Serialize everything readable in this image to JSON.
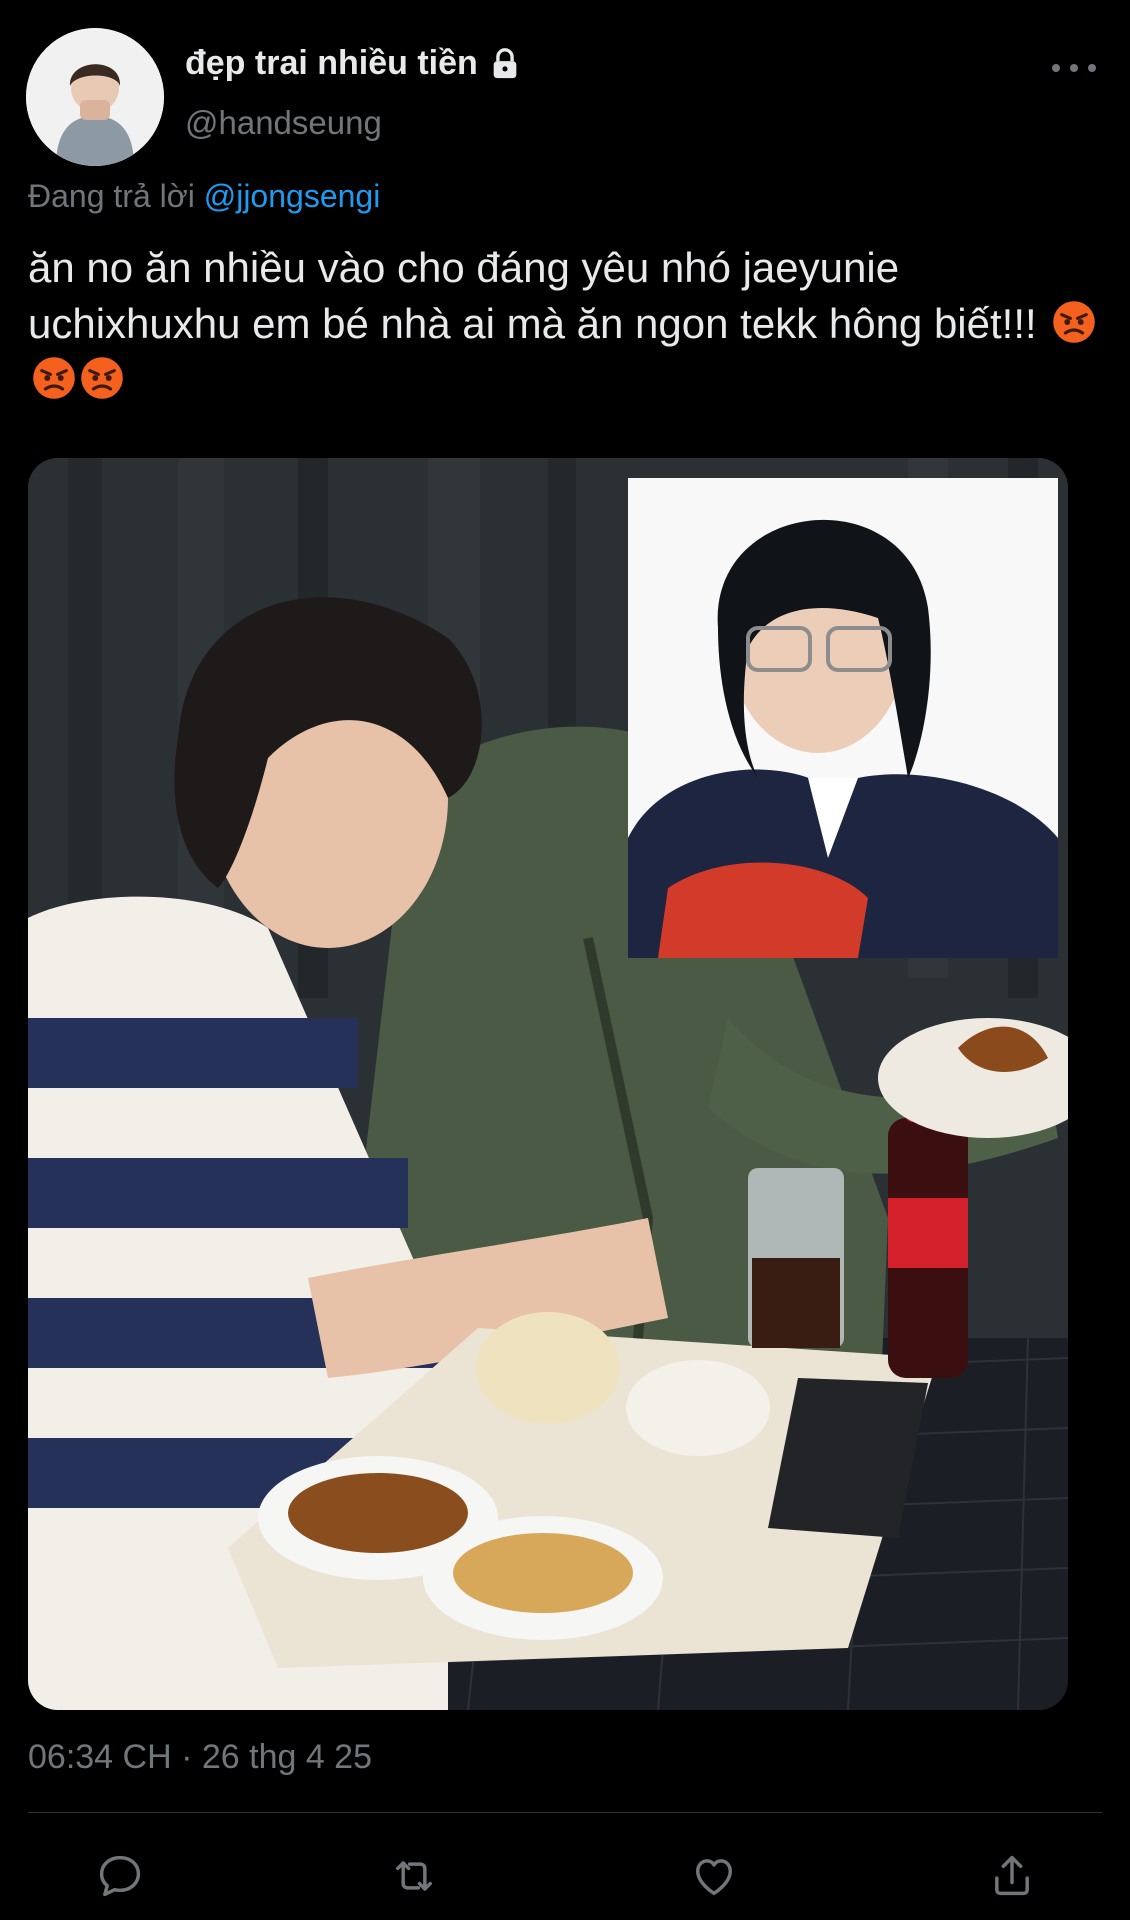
{
  "user": {
    "display_name": "đẹp trai nhiều tiền",
    "handle": "@handseung",
    "avatar_icon": "avatar",
    "protected_icon": "lock-icon"
  },
  "reply": {
    "prefix": "Đang trả lời ",
    "mention": "@jjongsengi"
  },
  "tweet": {
    "text": "ăn no ăn nhiều vào cho đáng yêu nhó jaeyunie uchixhuxhu em bé nhà ai mà ăn ngon tekk hông biết!!!",
    "emojis": [
      "angry-face-emoji",
      "angry-face-emoji",
      "angry-face-emoji"
    ]
  },
  "media": {
    "type": "photo",
    "icon": "photo"
  },
  "meta": {
    "timestamp": "06:34 CH · 26 thg 4 25"
  },
  "actions": [
    {
      "name": "reply",
      "icon": "reply-icon"
    },
    {
      "name": "retweet",
      "icon": "retweet-icon"
    },
    {
      "name": "like",
      "icon": "heart-icon"
    },
    {
      "name": "share",
      "icon": "share-icon"
    }
  ],
  "colors": {
    "background": "#000000",
    "text": "#e7e9ea",
    "muted": "#71767b",
    "accent": "#1d9bf0",
    "divider": "#2f3336"
  }
}
